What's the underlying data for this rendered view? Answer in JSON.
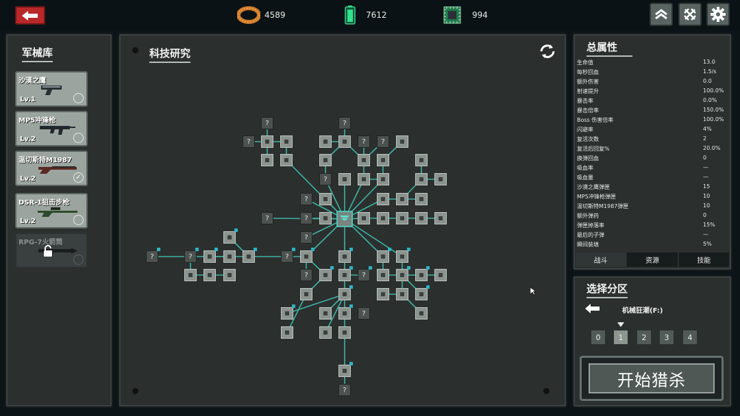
{
  "topbar": {
    "resources": [
      {
        "icon": "coil-icon",
        "value": "4589"
      },
      {
        "icon": "battery-icon",
        "value": "7612"
      },
      {
        "icon": "chip-icon",
        "value": "994"
      }
    ],
    "buttons": [
      "rank-up-icon",
      "crossed-swords-icon",
      "gear-icon"
    ]
  },
  "armory": {
    "title": "军械库",
    "weapons": [
      {
        "name": "沙漠之鹰",
        "level": "Lv.1",
        "equipped": false,
        "locked": false,
        "gun": "pistol"
      },
      {
        "name": "MP5冲锋枪",
        "level": "Lv.2",
        "equipped": false,
        "locked": false,
        "gun": "smg"
      },
      {
        "name": "温切斯特M1987",
        "level": "Lv.2",
        "equipped": true,
        "locked": false,
        "gun": "shotgun"
      },
      {
        "name": "DSR-1狙击步枪",
        "level": "Lv.2",
        "equipped": false,
        "locked": false,
        "gun": "sniper"
      },
      {
        "name": "RPG-7火箭筒",
        "level": "",
        "equipped": false,
        "locked": true,
        "gun": "rpg"
      }
    ]
  },
  "tech": {
    "title": "科技研究",
    "unknown_label": "?"
  },
  "stats": {
    "title": "总属性",
    "rows": [
      {
        "label": "生命值",
        "value": "13.0"
      },
      {
        "label": "每秒回血",
        "value": "1.5/s"
      },
      {
        "label": "额外伤害",
        "value": "0.0"
      },
      {
        "label": "射速提升",
        "value": "100.0%"
      },
      {
        "label": "暴击率",
        "value": "0.0%"
      },
      {
        "label": "暴击倍率",
        "value": "150.0%"
      },
      {
        "label": "Boss 伤害倍率",
        "value": "100.0%"
      },
      {
        "label": "闪避率",
        "value": "4%"
      },
      {
        "label": "复活次数",
        "value": "2"
      },
      {
        "label": "复活后回复%",
        "value": "20.0%"
      },
      {
        "label": "换弹回血",
        "value": "0"
      },
      {
        "label": "吸血率",
        "value": "—"
      },
      {
        "label": "吸血量",
        "value": "—"
      },
      {
        "label": "沙漠之鹰弹匣",
        "value": "15"
      },
      {
        "label": "MP5冲锋枪弹匣",
        "value": "10"
      },
      {
        "label": "温切斯特M1987弹匣",
        "value": "10"
      },
      {
        "label": "额外弹药",
        "value": "0"
      },
      {
        "label": "弹匣掉落率",
        "value": "15%"
      },
      {
        "label": "最后的子弹",
        "value": "—"
      },
      {
        "label": "瞬间装填",
        "value": "5%"
      }
    ],
    "tabs": [
      "战斗",
      "资源",
      "技能"
    ],
    "active_tab": "战斗"
  },
  "zone": {
    "title": "选择分区",
    "current": "机械狂潮(F:)",
    "options": [
      "0",
      "1",
      "2",
      "3",
      "4"
    ],
    "selected": "1"
  },
  "start_label": "开始猎杀",
  "colors": {
    "accent": "#4fc4b4",
    "back_button": "#b8282a",
    "panel": "#2b302f"
  }
}
